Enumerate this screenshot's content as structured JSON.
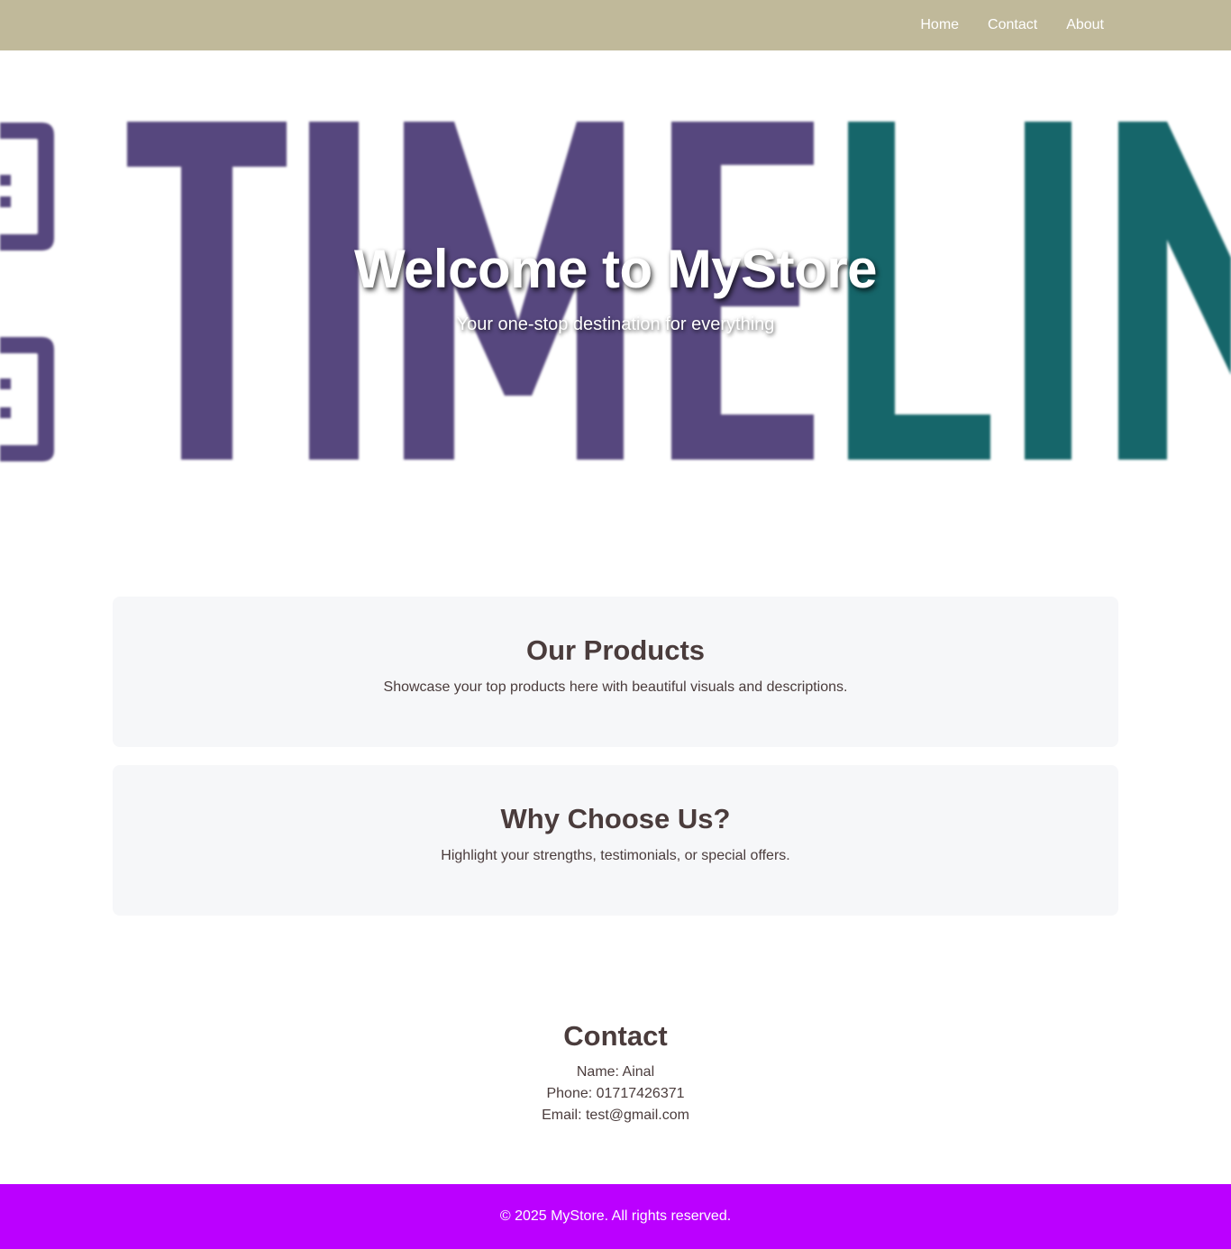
{
  "nav": {
    "links": [
      {
        "label": "Home"
      },
      {
        "label": "Contact"
      },
      {
        "label": "About"
      }
    ]
  },
  "hero": {
    "title": "Welcome to MyStore",
    "subtitle": "Your one-stop destination for everything",
    "background_text": "TIMELINE",
    "colors": {
      "purple": "#56467e",
      "teal": "#16666a"
    }
  },
  "sections": [
    {
      "title": "Our Products",
      "text": "Showcase your top products here with beautiful visuals and descriptions."
    },
    {
      "title": "Why Choose Us?",
      "text": "Highlight your strengths, testimonials, or special offers."
    }
  ],
  "contact": {
    "title": "Contact",
    "name": "Name: Ainal",
    "phone": "Phone: 01717426371",
    "email": "Email: test@gmail.com"
  },
  "footer": {
    "text": "© 2025 MyStore. All rights reserved."
  },
  "colors": {
    "navbar": "#c0b99a",
    "footer": "#bb00ff",
    "card_bg": "#f6f7f9",
    "text": "#4a3c3c"
  }
}
